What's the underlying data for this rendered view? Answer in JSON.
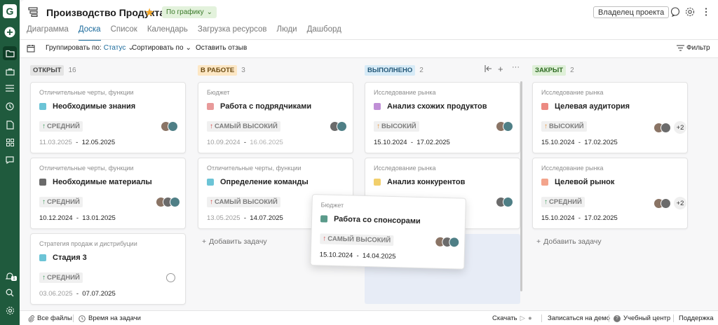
{
  "header": {
    "title": "Производство Продукта",
    "status": "По графику",
    "owner_button": "Владелец проекта"
  },
  "tabs": [
    "Диаграмма",
    "Доска",
    "Список",
    "Календарь",
    "Загрузка ресурсов",
    "Люди",
    "Дашборд"
  ],
  "active_tab": "Доска",
  "toolbar": {
    "group_by_label": "Группировать по:",
    "group_by_value": "Статус",
    "sort_label": "Сортировать по",
    "feedback": "Оставить отзыв",
    "filter": "Фильтр"
  },
  "colors": {
    "rail": "#1f5a3d",
    "accent": "#1c6b9c",
    "open_badge": "#e4e4e4",
    "in_progress_badge": "#fde7c4",
    "done_badge": "#d7ebf7",
    "closed_badge": "#dff0d8"
  },
  "columns": [
    {
      "label": "ОТКРЫТ",
      "count": "16",
      "cards": [
        {
          "category": "Отличительные черты, функции",
          "name": "Необходимые знания",
          "square": "#6cc4d6",
          "priority": "СРЕДНИЙ",
          "arrow": "↑",
          "arrow_color": "#3a9a5b",
          "start": "11.03.2025",
          "end": "12.05.2025"
        },
        {
          "category": "Отличительные черты, функции",
          "name": "Необходимые материалы",
          "square": "#6a6a6a",
          "priority": "СРЕДНИЙ",
          "arrow": "↑",
          "arrow_color": "#3a9a5b",
          "start": "10.12.2024",
          "end": "13.01.2025"
        },
        {
          "category": "Стратегия продаж и дистрибуции",
          "name": "Стадия 3",
          "square": "#6cc4d6",
          "priority": "СРЕДНИЙ",
          "arrow": "↑",
          "arrow_color": "#3a9a5b",
          "start": "03.06.2025",
          "end": "07.07.2025"
        }
      ]
    },
    {
      "label": "В РАБОТЕ",
      "count": "3",
      "add_task": "Добавить задачу",
      "cards": [
        {
          "category": "Бюджет",
          "name": "Работа с подрядчиками",
          "square": "#e89a9a",
          "priority": "САМЫЙ ВЫСОКИЙ",
          "arrow": "↑",
          "arrow_color": "#d64545",
          "start": "10.09.2024",
          "end": "16.06.2025"
        },
        {
          "category": "Отличительные черты, функции",
          "name": "Определение команды",
          "square": "#6cc4d6",
          "priority": "САМЫЙ ВЫСОКИЙ",
          "arrow": "↑",
          "arrow_color": "#d64545",
          "start": "13.05.2025",
          "end": "14.07.2025"
        }
      ]
    },
    {
      "label": "ВЫПОЛНЕНО",
      "count": "2",
      "cards": [
        {
          "category": "Исследование рынка",
          "name": "Анализ схожих продуктов",
          "square": "#c08fd6",
          "priority": "ВЫСОКИЙ",
          "arrow": "↑",
          "arrow_color": "#e8943a",
          "start": "15.10.2024",
          "end": "17.02.2025"
        },
        {
          "category": "Исследование рынка",
          "name": "Анализ конкурентов",
          "square": "#f2cf6b",
          "priority": "",
          "arrow": "",
          "arrow_color": "#e8943a",
          "start": "",
          "end": ""
        }
      ]
    },
    {
      "label": "ЗАКРЫТ",
      "count": "2",
      "add_task": "Добавить задачу",
      "cards": [
        {
          "category": "Исследование рынка",
          "name": "Целевая аудитория",
          "square": "#ec8a82",
          "priority": "ВЫСОКИЙ",
          "arrow": "↑",
          "arrow_color": "#e8943a",
          "start": "15.10.2024",
          "end": "17.02.2025",
          "extra": "+2"
        },
        {
          "category": "Исследование рынка",
          "name": "Целевой рынок",
          "square": "#f3a48c",
          "priority": "СРЕДНИЙ",
          "arrow": "↑",
          "arrow_color": "#3a9a5b",
          "start": "15.10.2024",
          "end": "17.02.2025",
          "extra": "+2"
        }
      ]
    }
  ],
  "dragged_card": {
    "category": "Бюджет",
    "name": "Работа со спонсорами",
    "square": "#5a9a8a",
    "priority": "САМЫЙ ВЫСОКИЙ",
    "arrow": "↑",
    "arrow_color": "#d64545",
    "start": "15.10.2024",
    "end": "14.04.2025"
  },
  "date_separator": "-",
  "footer": {
    "all_files": "Все файлы",
    "time_on_tasks": "Время на задачи",
    "download": "Скачать",
    "demo": "Записаться на демо",
    "learning": "Учебный центр",
    "support": "Поддержка"
  },
  "rail": {
    "logo": "G",
    "notification_count": "1"
  }
}
